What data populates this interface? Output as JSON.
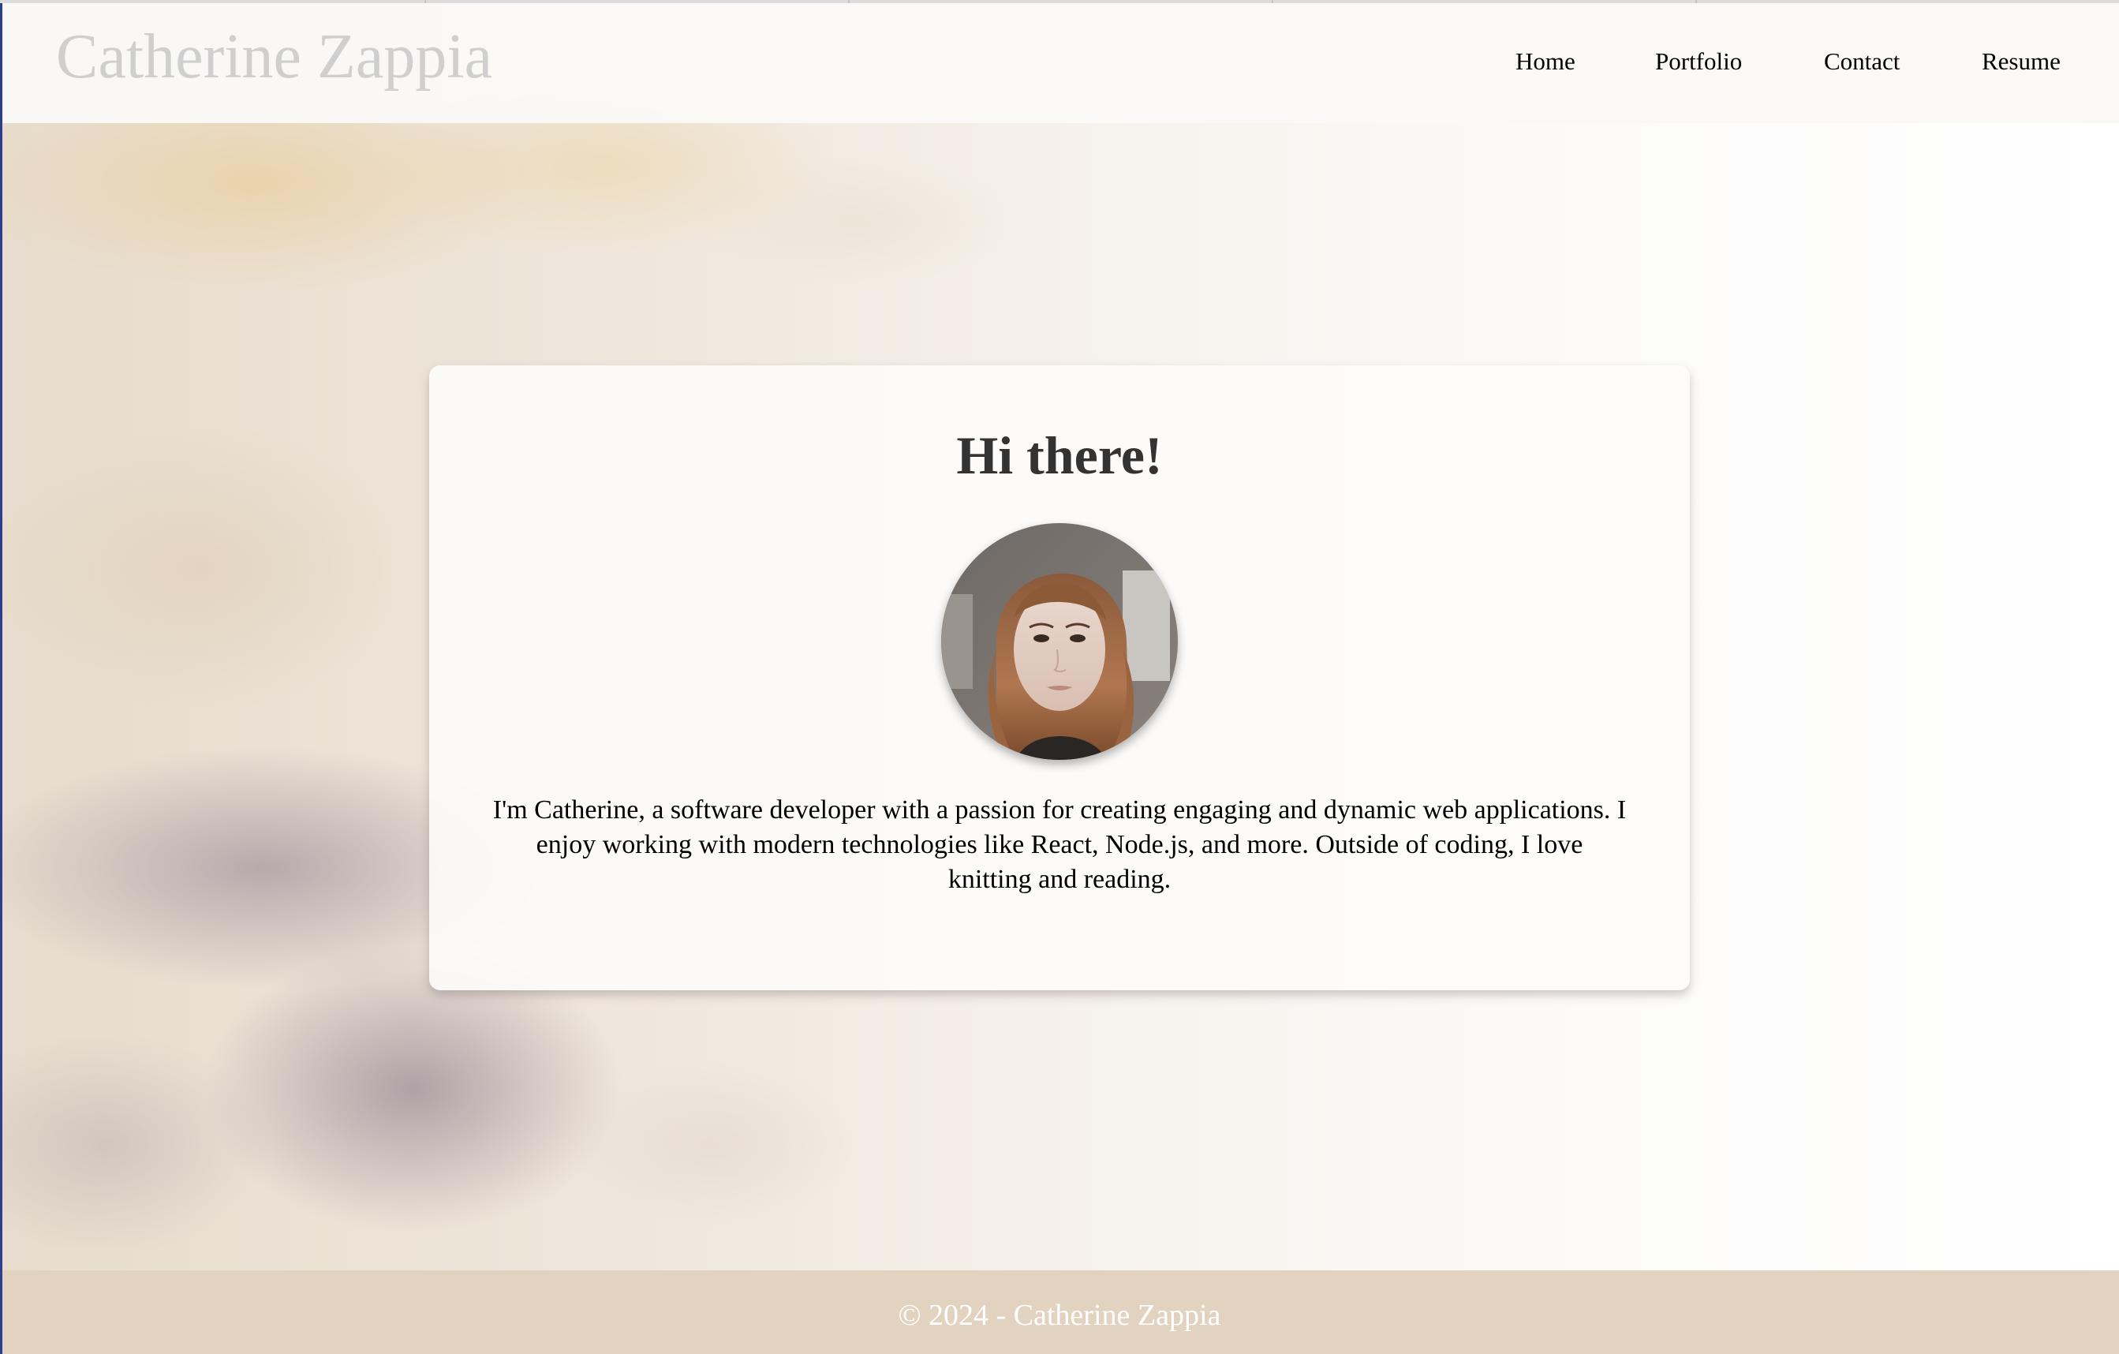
{
  "site": {
    "title": "Catherine Zappia"
  },
  "nav": {
    "items": [
      {
        "label": "Home"
      },
      {
        "label": "Portfolio"
      },
      {
        "label": "Contact"
      },
      {
        "label": "Resume"
      }
    ]
  },
  "hero": {
    "heading": "Hi there!",
    "bio": "I'm Catherine, a software developer with a passion for creating engaging and dynamic web applications. I enjoy working with modern technologies like React, Node.js, and more. Outside of coding, I love knitting and reading."
  },
  "footer": {
    "copyright": "© 2024 - Catherine Zappia"
  },
  "colors": {
    "footer_bg": "#e2d3c0",
    "header_bg": "#faf9f7",
    "title_text": "#cfcfcf",
    "heading_text": "#333333"
  },
  "icons": {
    "profile_photo": "profile-photo"
  }
}
